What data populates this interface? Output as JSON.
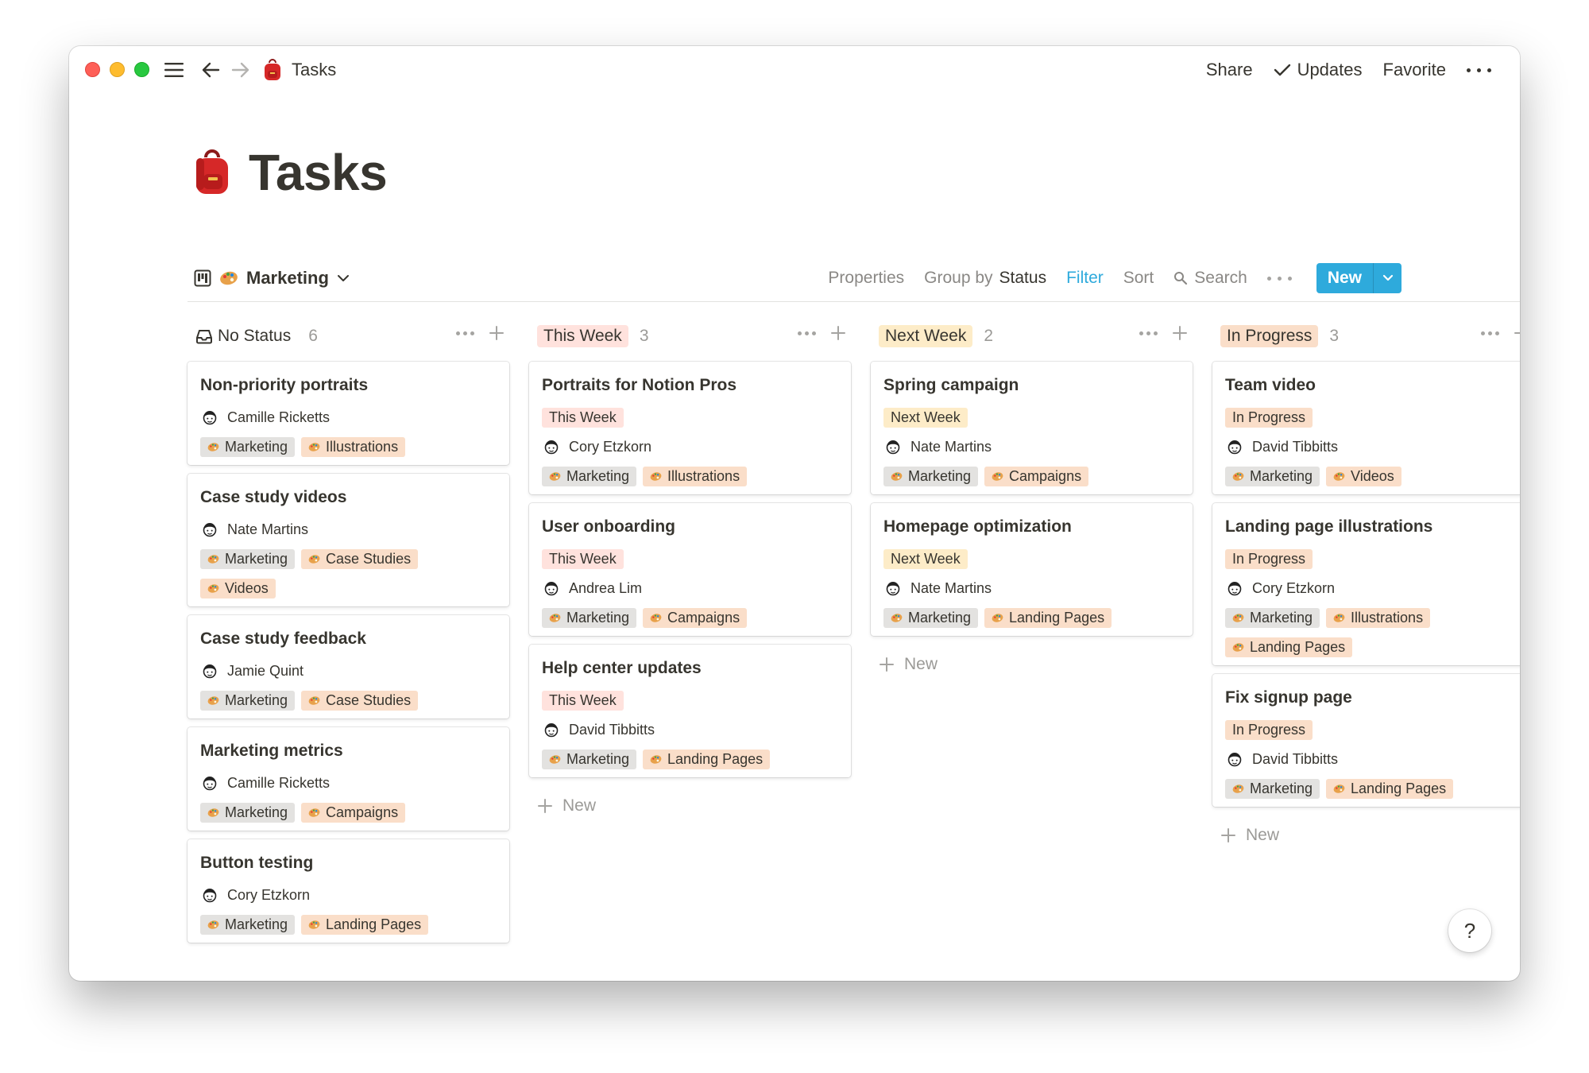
{
  "window": {
    "title": "Tasks",
    "actions": {
      "share": "Share",
      "updates": "Updates",
      "favorite": "Favorite"
    }
  },
  "page": {
    "title": "Tasks",
    "icon": "backpack-icon"
  },
  "view": {
    "name": "Marketing",
    "properties": "Properties",
    "group_by_prefix": "Group by",
    "group_by_value": "Status",
    "filter": "Filter",
    "sort": "Sort",
    "search": "Search",
    "new": "New"
  },
  "colors": {
    "accent": "#2eaadc",
    "text": "#37352f",
    "muted": "#9b9a97"
  },
  "new_label": "New",
  "help": "?",
  "columns": [
    {
      "label": "No Status",
      "count": "6",
      "style": "none",
      "cards": [
        {
          "title": "Non-priority portraits",
          "person": "Camille Ricketts",
          "tags": [
            "Marketing",
            "Illustrations"
          ]
        },
        {
          "title": "Case study videos",
          "person": "Nate Martins",
          "tags": [
            "Marketing",
            "Case Studies",
            "Videos"
          ]
        },
        {
          "title": "Case study feedback",
          "person": "Jamie Quint",
          "tags": [
            "Marketing",
            "Case Studies"
          ]
        },
        {
          "title": "Marketing metrics",
          "person": "Camille Ricketts",
          "tags": [
            "Marketing",
            "Campaigns"
          ]
        },
        {
          "title": "Button testing",
          "person": "Cory Etzkorn",
          "tags": [
            "Marketing",
            "Landing Pages"
          ]
        }
      ]
    },
    {
      "label": "This Week",
      "count": "3",
      "style": "red",
      "cards": [
        {
          "title": "Portraits for Notion Pros",
          "status": "This Week",
          "person": "Cory Etzkorn",
          "tags": [
            "Marketing",
            "Illustrations"
          ]
        },
        {
          "title": "User onboarding",
          "status": "This Week",
          "person": "Andrea Lim",
          "tags": [
            "Marketing",
            "Campaigns"
          ]
        },
        {
          "title": "Help center updates",
          "status": "This Week",
          "person": "David Tibbitts",
          "tags": [
            "Marketing",
            "Landing Pages"
          ]
        }
      ]
    },
    {
      "label": "Next Week",
      "count": "2",
      "style": "orange",
      "cards": [
        {
          "title": "Spring campaign",
          "status": "Next Week",
          "person": "Nate Martins",
          "tags": [
            "Marketing",
            "Campaigns"
          ]
        },
        {
          "title": "Homepage optimization",
          "status": "Next Week",
          "person": "Nate Martins",
          "tags": [
            "Marketing",
            "Landing Pages"
          ]
        }
      ]
    },
    {
      "label": "In Progress",
      "count": "3",
      "style": "peach",
      "cards": [
        {
          "title": "Team video",
          "status": "In Progress",
          "person": "David Tibbitts",
          "tags": [
            "Marketing",
            "Videos"
          ]
        },
        {
          "title": "Landing page illustrations",
          "status": "In Progress",
          "person": "Cory Etzkorn",
          "tags": [
            "Marketing",
            "Illustrations",
            "Landing Pages"
          ]
        },
        {
          "title": "Fix signup page",
          "status": "In Progress",
          "person": "David Tibbitts",
          "tags": [
            "Marketing",
            "Landing Pages"
          ]
        }
      ]
    }
  ]
}
